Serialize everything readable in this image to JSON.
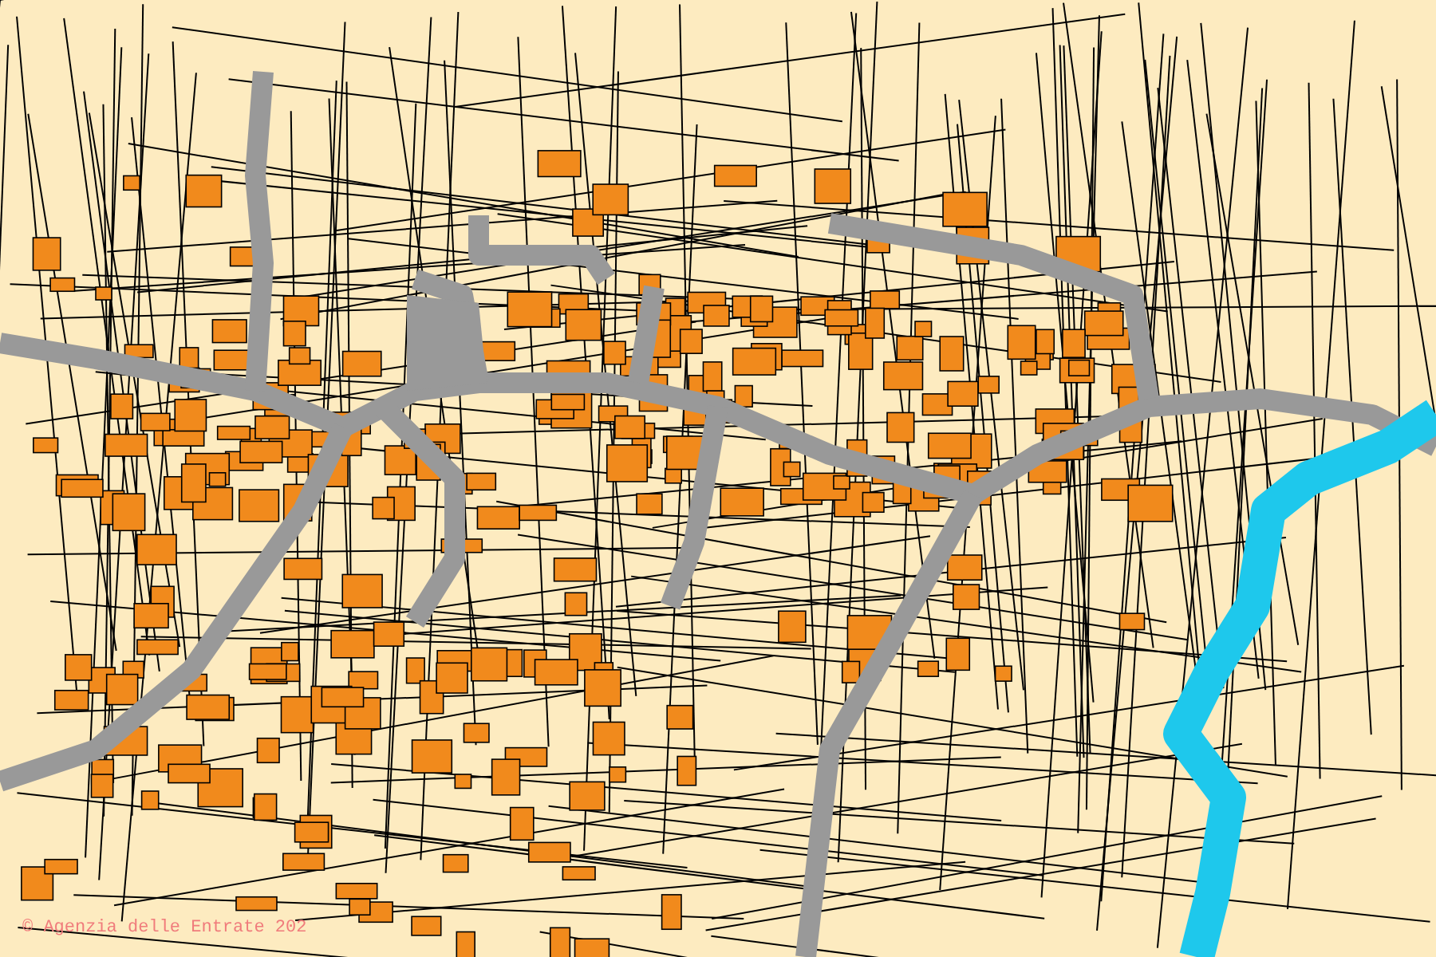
{
  "map": {
    "attribution": "© Agenzia delle Entrate 202"
  }
}
